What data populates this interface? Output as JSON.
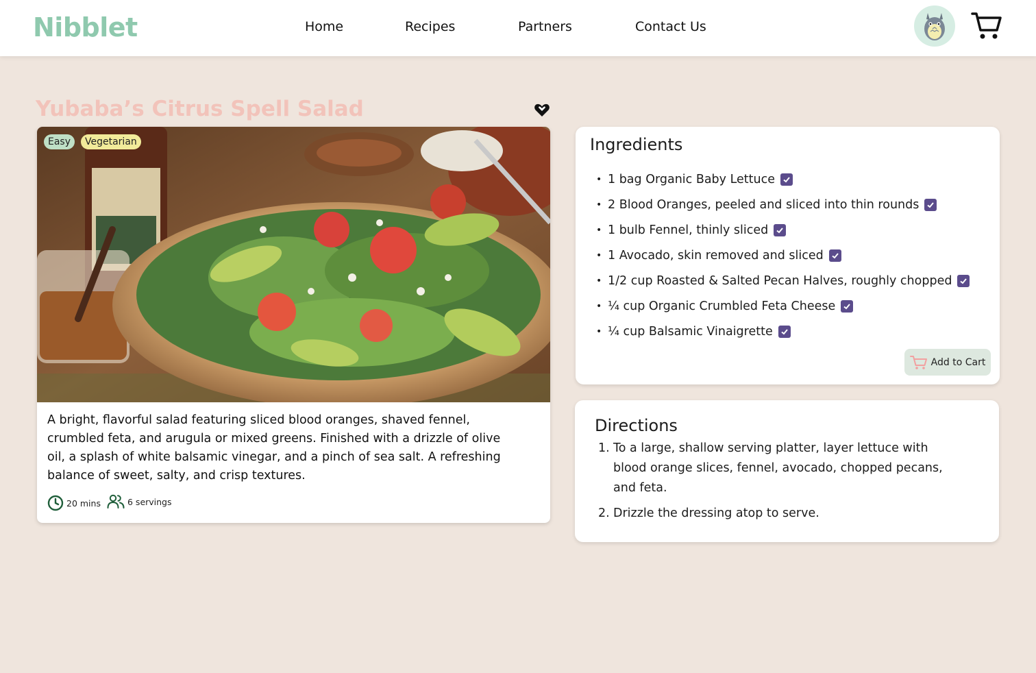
{
  "header": {
    "logo": "Nibblet",
    "nav": [
      "Home",
      "Recipes",
      "Partners",
      "Contact Us"
    ],
    "avatar_icon": "totoro-avatar-icon",
    "cart_icon": "cart-icon"
  },
  "recipe": {
    "title": "Yubaba’s Citrus Spell Salad",
    "tags": [
      "Easy",
      "Vegetarian"
    ],
    "description": "A bright, flavorful salad featuring sliced blood oranges, shaved fennel, crumbled feta, and arugula or mixed greens. Finished with a drizzle of olive oil, a splash of white balsamic vinegar, and a pinch of sea salt. A refreshing balance of sweet, salty, and crisp textures.",
    "time": "20 mins",
    "servings": "6 servings",
    "favorite_icon": "heart-icon"
  },
  "ingredients": {
    "heading": "Ingredients",
    "items": [
      "1 bag Organic Baby Lettuce",
      "2 Blood Oranges, peeled and sliced into thin rounds",
      "1 bulb Fennel, thinly sliced",
      "1 Avocado, skin removed and sliced",
      "1/2 cup Roasted & Salted Pecan Halves, roughly chopped",
      "¼ cup Organic Crumbled Feta Cheese",
      "¼ cup Balsamic Vinaigrette"
    ],
    "add_to_cart": "Add to Cart"
  },
  "directions": {
    "heading": "Directions",
    "steps": [
      "To a large, shallow serving platter, layer lettuce with blood orange slices, fennel, avocado, chopped pecans, and feta.",
      "Drizzle the dressing atop to serve."
    ]
  },
  "colors": {
    "background": "#EFE5DD",
    "logo": "#8FC9AE",
    "title": "#F2C3BA",
    "checkbox": "#5B4C8C",
    "tag_easy": "#BFE0C6",
    "tag_vegetarian": "#F2EB9A",
    "add_to_cart_bg": "#DDE8DF"
  }
}
